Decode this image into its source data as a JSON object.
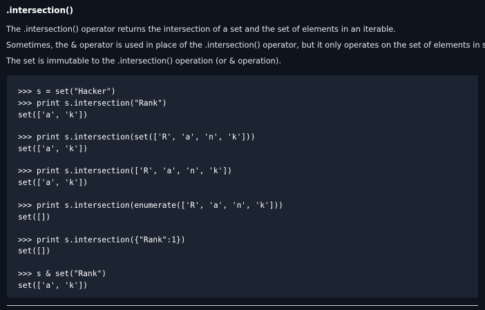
{
  "title": ".intersection()",
  "paragraphs": [
    "The .intersection() operator returns the intersection of a set and the set of elements in an iterable.",
    "Sometimes, the & operator is used in place of the .intersection() operator, but it only operates on the set of elements in set.",
    "The set is immutable to the .intersection() operation (or & operation)."
  ],
  "code": [
    ">>> s = set(\"Hacker\")",
    ">>> print s.intersection(\"Rank\")",
    "set(['a', 'k'])",
    ">>> print s.intersection(set(['R', 'a', 'n', 'k']))",
    "set(['a', 'k'])",
    ">>> print s.intersection(['R', 'a', 'n', 'k'])",
    "set(['a', 'k'])",
    ">>> print s.intersection(enumerate(['R', 'a', 'n', 'k']))",
    "set([])",
    ">>> print s.intersection({\"Rank\":1})",
    "set([])",
    ">>> s & set(\"Rank\")",
    "set(['a', 'k'])"
  ]
}
